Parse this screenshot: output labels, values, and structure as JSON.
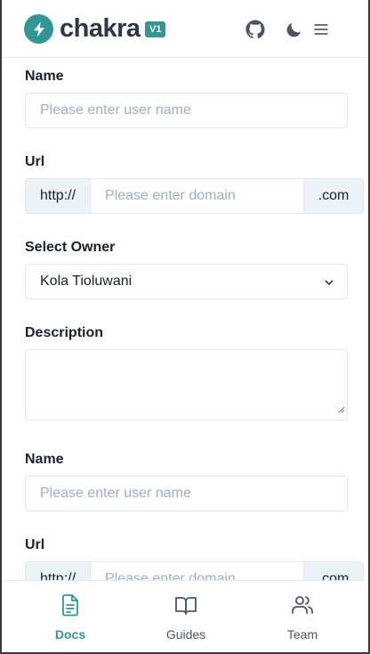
{
  "header": {
    "logo": "chakra",
    "version": "V1",
    "icons": [
      "github-icon",
      "moon-icon",
      "menu-icon"
    ]
  },
  "form": {
    "name_label": "Name",
    "name_placeholder": "Please enter user name",
    "url_label": "Url",
    "url_prefix": "http://",
    "url_placeholder": "Please enter domain",
    "url_suffix": ".com",
    "owner_label": "Select Owner",
    "owner_value": "Kola Tioluwani",
    "description_label": "Description",
    "description_value": ""
  },
  "form2": {
    "name_label": "Name",
    "name_placeholder": "Please enter user name",
    "url_label": "Url",
    "url_prefix": "http://",
    "url_placeholder": "Please enter domain",
    "url_suffix": ".com"
  },
  "bottom_nav": {
    "items": [
      {
        "label": "Docs",
        "icon": "document-icon",
        "active": true
      },
      {
        "label": "Guides",
        "icon": "book-icon",
        "active": false
      },
      {
        "label": "Team",
        "icon": "users-icon",
        "active": false
      }
    ]
  },
  "colors": {
    "accent": "#319795",
    "border": "#e2e8f0",
    "addon_bg": "#edf2f7",
    "placeholder": "#a0aec0",
    "icon": "#4a5568"
  }
}
